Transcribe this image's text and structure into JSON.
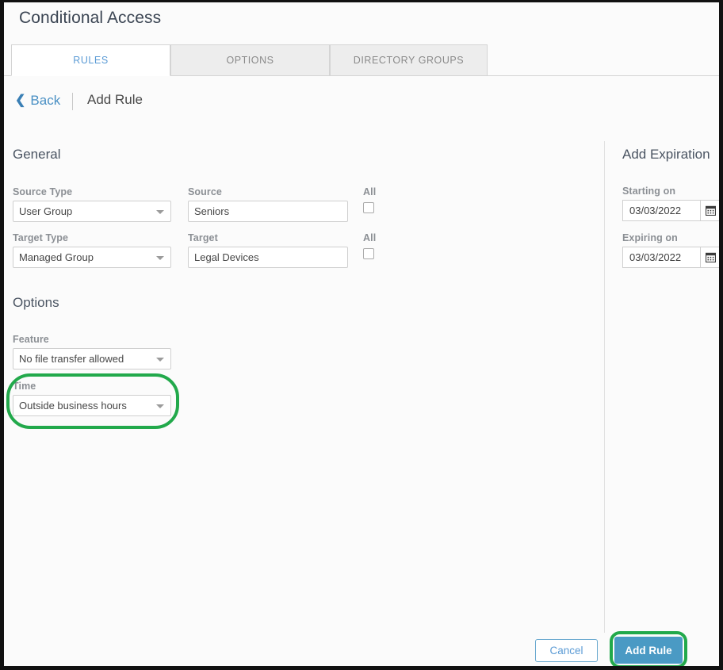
{
  "window": {
    "title": "Conditional Access"
  },
  "tabs": [
    {
      "label": "RULES",
      "active": true
    },
    {
      "label": "OPTIONS",
      "active": false
    },
    {
      "label": "DIRECTORY GROUPS",
      "active": false
    }
  ],
  "breadcrumb": {
    "back_label": "Back",
    "back_icon": "chevron-left-icon",
    "current": "Add Rule"
  },
  "sections": {
    "general": {
      "heading": "General",
      "source_type": {
        "label": "Source Type",
        "value": "User Group",
        "icon": "chevron-down-icon"
      },
      "target_type": {
        "label": "Target Type",
        "value": "Managed Group",
        "icon": "chevron-down-icon"
      },
      "source": {
        "label": "Source",
        "value": "Seniors",
        "placeholder": ""
      },
      "target": {
        "label": "Target",
        "value": "Legal Devices",
        "placeholder": ""
      },
      "source_all": {
        "label": "All",
        "checked": false
      },
      "target_all": {
        "label": "All",
        "checked": false
      }
    },
    "options": {
      "heading": "Options",
      "feature": {
        "label": "Feature",
        "value": "No file transfer allowed",
        "icon": "chevron-down-icon"
      },
      "time": {
        "label": "Time",
        "value": "Outside business hours",
        "icon": "chevron-down-icon"
      }
    },
    "expiration": {
      "heading": "Add Expiration",
      "starting_on": {
        "label": "Starting on",
        "value": "03/03/2022",
        "icon": "calendar-icon"
      },
      "expiring_on": {
        "label": "Expiring on",
        "value": "03/03/2022",
        "icon": "calendar-icon"
      }
    }
  },
  "footer": {
    "cancel_label": "Cancel",
    "add_rule_label": "Add Rule"
  },
  "annotations": {
    "color": "#22a94b",
    "targets": [
      "time-dropdown",
      "add-rule-button"
    ]
  },
  "colors": {
    "accent_blue": "#4a9ac4",
    "tab_active_text": "#5b9bd5",
    "link_blue": "#4a90c4",
    "label_grey": "#8b8f94",
    "page_bg": "#fbfbfb",
    "frame": "#111111"
  }
}
